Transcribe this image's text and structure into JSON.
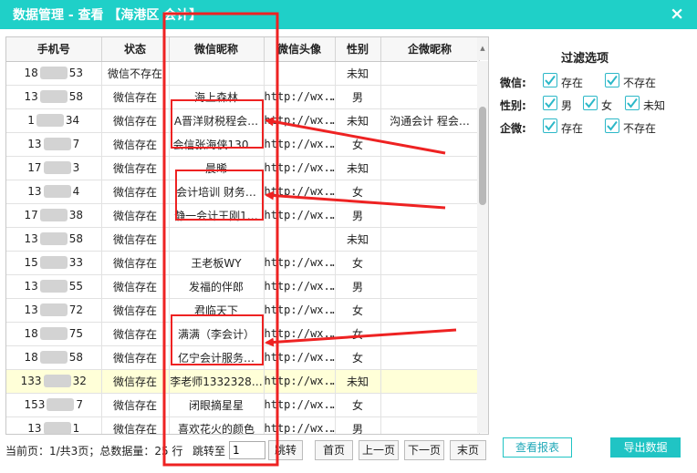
{
  "window": {
    "title": "数据管理 - 查看 【海港区 会计】",
    "close_icon": "×"
  },
  "table": {
    "columns": [
      "手机号",
      "状态",
      "微信昵称",
      "微信头像",
      "性别",
      "企微昵称"
    ],
    "rows": [
      {
        "phone_prefix": "18",
        "phone_suffix": "53",
        "status": "微信不存在",
        "nickname": "",
        "avatar": "",
        "gender": "未知",
        "wecom": "",
        "highlight": false
      },
      {
        "phone_prefix": "13",
        "phone_suffix": "58",
        "status": "微信存在",
        "nickname": "海上森林",
        "avatar": "http://wx.…",
        "gender": "男",
        "wecom": "",
        "highlight": false
      },
      {
        "phone_prefix": "1",
        "phone_suffix": "34",
        "status": "微信存在",
        "nickname": "A晋洋财税程会…",
        "avatar": "http://wx.…",
        "gender": "未知",
        "wecom": "沟通会计 程会…",
        "highlight": false
      },
      {
        "phone_prefix": "13",
        "phone_suffix": "7",
        "status": "微信存在",
        "nickname": "会信张海侠130…",
        "avatar": "http://wx.…",
        "gender": "女",
        "wecom": "",
        "highlight": false
      },
      {
        "phone_prefix": "17",
        "phone_suffix": "3",
        "status": "微信存在",
        "nickname": "晨晞",
        "avatar": "http://wx.…",
        "gender": "未知",
        "wecom": "",
        "highlight": false
      },
      {
        "phone_prefix": "13",
        "phone_suffix": "4",
        "status": "微信存在",
        "nickname": "会计培训 财务…",
        "avatar": "http://wx.…",
        "gender": "女",
        "wecom": "",
        "highlight": false
      },
      {
        "phone_prefix": "17",
        "phone_suffix": "38",
        "status": "微信存在",
        "nickname": "静一会计王刚1…",
        "avatar": "http://wx.…",
        "gender": "男",
        "wecom": "",
        "highlight": false
      },
      {
        "phone_prefix": "13",
        "phone_suffix": "58",
        "status": "微信存在",
        "nickname": "",
        "avatar": "",
        "gender": "未知",
        "wecom": "",
        "highlight": false
      },
      {
        "phone_prefix": "15",
        "phone_suffix": "33",
        "status": "微信存在",
        "nickname": "王老板WY",
        "avatar": "http://wx.…",
        "gender": "女",
        "wecom": "",
        "highlight": false
      },
      {
        "phone_prefix": "13",
        "phone_suffix": "55",
        "status": "微信存在",
        "nickname": "发福的伴郎",
        "avatar": "http://wx.…",
        "gender": "男",
        "wecom": "",
        "highlight": false
      },
      {
        "phone_prefix": "13",
        "phone_suffix": "72",
        "status": "微信存在",
        "nickname": "君临天下",
        "avatar": "http://wx.…",
        "gender": "女",
        "wecom": "",
        "highlight": false
      },
      {
        "phone_prefix": "18",
        "phone_suffix": "75",
        "status": "微信存在",
        "nickname": "满满（李会计）",
        "avatar": "http://wx.…",
        "gender": "女",
        "wecom": "",
        "highlight": false
      },
      {
        "phone_prefix": "18",
        "phone_suffix": "58",
        "status": "微信存在",
        "nickname": "亿宁会计服务…",
        "avatar": "http://wx.…",
        "gender": "女",
        "wecom": "",
        "highlight": false
      },
      {
        "phone_prefix": "133",
        "phone_suffix": "32",
        "status": "微信存在",
        "nickname": "李老师1332328…",
        "avatar": "http://wx.…",
        "gender": "未知",
        "wecom": "",
        "highlight": true
      },
      {
        "phone_prefix": "153",
        "phone_suffix": "7",
        "status": "微信存在",
        "nickname": "闭眼摘星星",
        "avatar": "http://wx.…",
        "gender": "女",
        "wecom": "",
        "highlight": false
      },
      {
        "phone_prefix": "13",
        "phone_suffix": "1",
        "status": "微信存在",
        "nickname": "喜欢花火的颜色",
        "avatar": "http://wx.…",
        "gender": "男",
        "wecom": "",
        "highlight": false
      }
    ]
  },
  "pager": {
    "info": "当前页：1/共3页；总数据量：25 行",
    "jump_label": "跳转至",
    "jump_value": "1",
    "jump_button": "跳转",
    "first": "首页",
    "prev": "上一页",
    "next": "下一页",
    "last": "末页"
  },
  "filters": {
    "title": "过滤选项",
    "wechat_label": "微信:",
    "wechat_exists": "存在",
    "wechat_not_exists": "不存在",
    "gender_label": "性别:",
    "gender_male": "男",
    "gender_female": "女",
    "gender_unknown": "未知",
    "wecom_label": "企微:",
    "wecom_exists": "存在",
    "wecom_not_exists": "不存在"
  },
  "actions": {
    "view_report": "查看报表",
    "export_data": "导出数据"
  },
  "colors": {
    "accent": "#1fd0c8",
    "annotation_red": "#ee2222",
    "highlight_row": "#ffffd8"
  }
}
